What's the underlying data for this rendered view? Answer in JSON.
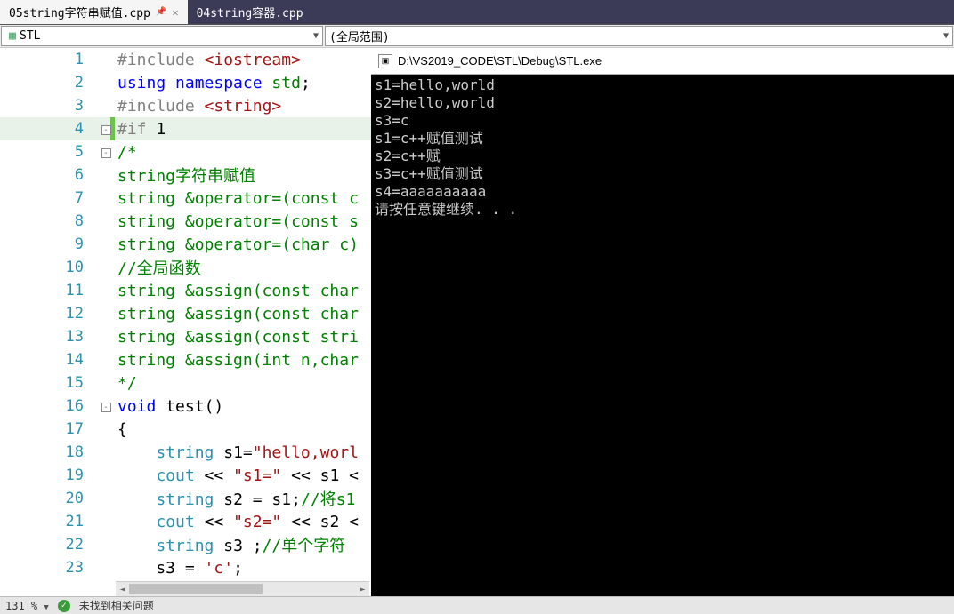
{
  "tabs": [
    {
      "label": "05string字符串赋值.cpp",
      "active": true
    },
    {
      "label": "04string容器.cpp",
      "active": false
    }
  ],
  "dropdowns": {
    "left": "STL",
    "right": "(全局范围)"
  },
  "code": {
    "lines": [
      {
        "n": 1,
        "html": "<span class='c-pp'>#include</span> <span class='c-inc'>&lt;iostream&gt;</span>"
      },
      {
        "n": 2,
        "html": "<span class='c-kw'>using</span> <span class='c-kw'>namespace</span> <span class='c-ns'>std</span>;"
      },
      {
        "n": 3,
        "html": "<span class='c-pp'>#include</span> <span class='c-inc'>&lt;string&gt;</span>"
      },
      {
        "n": 4,
        "html": "<span class='c-pp'>#if</span> 1",
        "fold": "-",
        "current": true
      },
      {
        "n": 5,
        "html": "<span class='c-com'>/*</span>",
        "fold": "-"
      },
      {
        "n": 6,
        "html": "<span class='c-com'>string字符串赋值</span>"
      },
      {
        "n": 7,
        "html": "<span class='c-com'>string &amp;operator=(const c</span>"
      },
      {
        "n": 8,
        "html": "<span class='c-com'>string &amp;operator=(const s</span>"
      },
      {
        "n": 9,
        "html": "<span class='c-com'>string &amp;operator=(char c)</span>"
      },
      {
        "n": 10,
        "html": "<span class='c-com'>//全局函数</span>"
      },
      {
        "n": 11,
        "html": "<span class='c-com'>string &amp;assign(const char</span>"
      },
      {
        "n": 12,
        "html": "<span class='c-com'>string &amp;assign(const char</span>"
      },
      {
        "n": 13,
        "html": "<span class='c-com'>string &amp;assign(const stri</span>"
      },
      {
        "n": 14,
        "html": "<span class='c-com'>string &amp;assign(int n,char</span>"
      },
      {
        "n": 15,
        "html": "<span class='c-com'>*/</span>"
      },
      {
        "n": 16,
        "html": "<span class='c-kw'>void</span> <span>test</span>()",
        "fold": "-"
      },
      {
        "n": 17,
        "html": "{"
      },
      {
        "n": 18,
        "html": "    <span class='c-type'>string</span> s1=<span class='c-str'>\"hello,worl</span>"
      },
      {
        "n": 19,
        "html": "    <span class='c-type'>cout</span> &lt;&lt; <span class='c-str'>\"s1=\"</span> &lt;&lt; s1 <"
      },
      {
        "n": 20,
        "html": "    <span class='c-type'>string</span> s2 = s1;<span class='c-com'>//将s1</span>"
      },
      {
        "n": 21,
        "html": "    <span class='c-type'>cout</span> &lt;&lt; <span class='c-str'>\"s2=\"</span> &lt;&lt; s2 <"
      },
      {
        "n": 22,
        "html": "    <span class='c-type'>string</span> s3 ;<span class='c-com'>//单个字符</span>"
      },
      {
        "n": 23,
        "html": "    s3 = <span class='c-str'>'c'</span>;"
      }
    ]
  },
  "console": {
    "title": "D:\\VS2019_CODE\\STL\\Debug\\STL.exe",
    "lines": [
      "s1=hello,world",
      "s2=hello,world",
      "s3=c",
      "s1=c++赋值测试",
      "s2=c++赋",
      "s3=c++赋值测试",
      "s4=aaaaaaaaaa",
      "请按任意键继续. . ."
    ]
  },
  "status": {
    "zoom": "131 %",
    "issues": "未找到相关问题"
  }
}
